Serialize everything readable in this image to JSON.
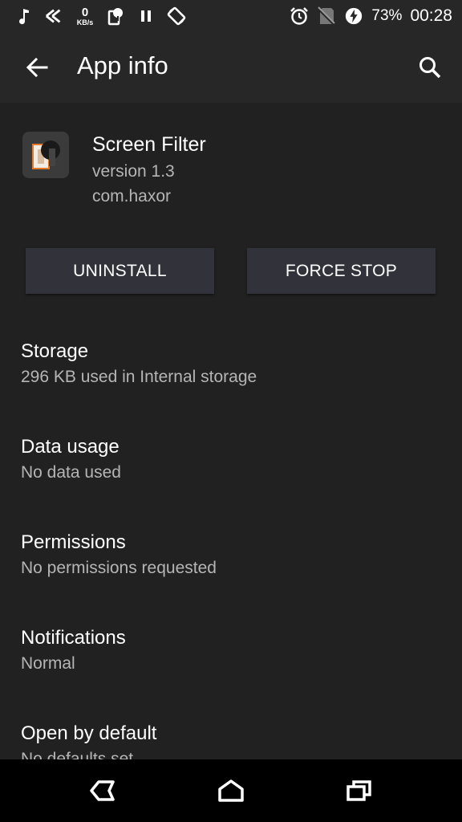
{
  "status_bar": {
    "left_icons": [
      "music-icon",
      "sync-icon",
      "network-speed-icon",
      "sim-icon",
      "pause-icon",
      "rotate-icon"
    ],
    "network_speed_value": "0",
    "network_speed_unit": "KB/s",
    "right_icons": [
      "alarm-icon",
      "no-signal-icon",
      "battery-charging-icon"
    ],
    "battery": "73%",
    "time": "00:28"
  },
  "app_bar": {
    "title": "App info"
  },
  "app": {
    "name": "Screen Filter",
    "version": "version 1.3",
    "package": "com.haxor"
  },
  "actions": {
    "uninstall": "UNINSTALL",
    "force_stop": "FORCE STOP"
  },
  "settings": [
    {
      "title": "Storage",
      "summary": "296 KB used in Internal storage"
    },
    {
      "title": "Data usage",
      "summary": "No data used"
    },
    {
      "title": "Permissions",
      "summary": "No permissions requested"
    },
    {
      "title": "Notifications",
      "summary": "Normal"
    },
    {
      "title": "Open by default",
      "summary": "No defaults set"
    }
  ],
  "colors": {
    "background": "#212121",
    "app_bar": "#272727",
    "button": "#32323b",
    "secondary_text": "#b5b5b5",
    "nav_bar": "#000000"
  }
}
